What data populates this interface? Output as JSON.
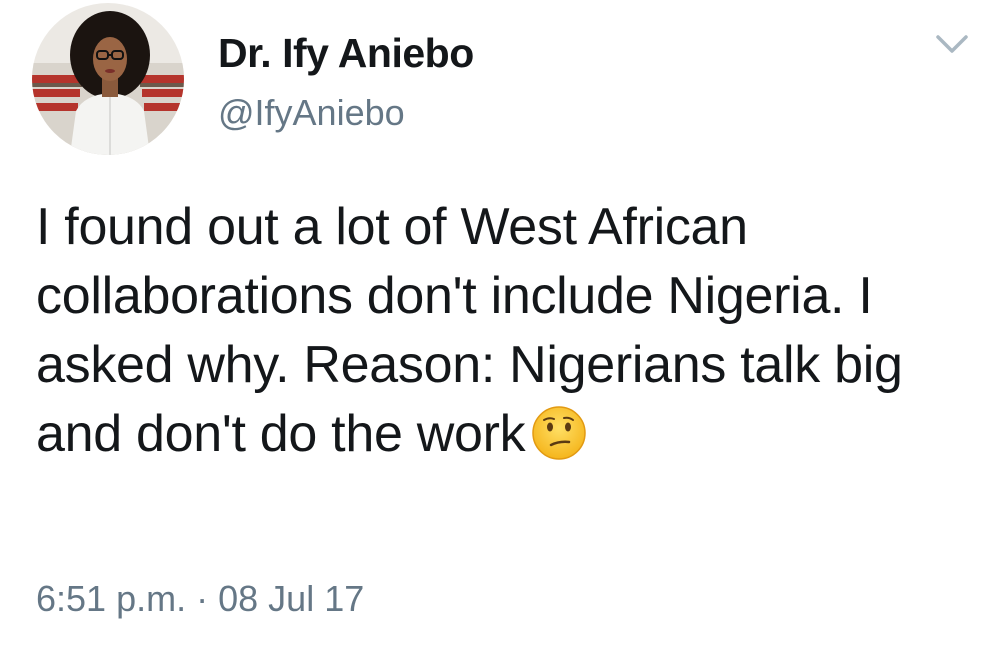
{
  "user": {
    "display_name": "Dr. Ify Aniebo",
    "handle": "@IfyAniebo",
    "avatar_icon": "profile-photo"
  },
  "tweet": {
    "text": "I found out a lot of West African collaborations don't include Nigeria. I asked why. Reason: Nigerians talk big and don't do the work",
    "emoji": "confused-face-icon",
    "time": "6:51 p.m.",
    "separator": "·",
    "date": "08 Jul 17"
  },
  "menu": {
    "icon": "chevron-down-icon"
  },
  "colors": {
    "text_primary": "#14171a",
    "text_secondary": "#657786",
    "chevron": "#aab8c2"
  }
}
